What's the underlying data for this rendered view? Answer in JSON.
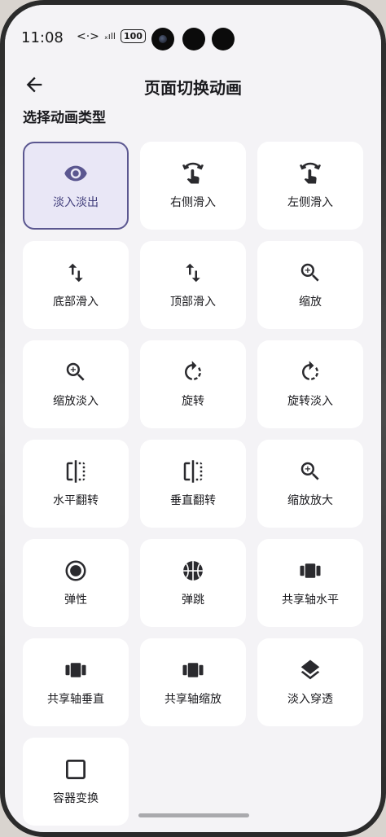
{
  "status_bar": {
    "time": "11:08",
    "network": "<·>",
    "signal": "ₓıll",
    "battery": "100"
  },
  "app_bar": {
    "title": "页面切换动画"
  },
  "section": {
    "label": "选择动画类型"
  },
  "colors": {
    "selected_border": "#5b5790",
    "selected_bg": "#e9e7f6",
    "card_bg": "#ffffff",
    "page_bg": "#f4f3f6"
  },
  "animations": [
    {
      "label": "淡入淡出",
      "icon": "eye-icon",
      "selected": true
    },
    {
      "label": "右侧滑入",
      "icon": "swipe-gesture-icon",
      "selected": false
    },
    {
      "label": "左侧滑入",
      "icon": "swipe-gesture-icon",
      "selected": false
    },
    {
      "label": "底部滑入",
      "icon": "swap-vertical-icon",
      "selected": false
    },
    {
      "label": "顶部滑入",
      "icon": "swap-vertical-icon",
      "selected": false
    },
    {
      "label": "缩放",
      "icon": "zoom-in-icon",
      "selected": false
    },
    {
      "label": "缩放淡入",
      "icon": "zoom-in-icon",
      "selected": false
    },
    {
      "label": "旋转",
      "icon": "rotate-icon",
      "selected": false
    },
    {
      "label": "旋转淡入",
      "icon": "rotate-icon",
      "selected": false
    },
    {
      "label": "水平翻转",
      "icon": "flip-icon",
      "selected": false
    },
    {
      "label": "垂直翻转",
      "icon": "flip-icon",
      "selected": false
    },
    {
      "label": "缩放放大",
      "icon": "zoom-in-icon",
      "selected": false
    },
    {
      "label": "弹性",
      "icon": "radio-target-icon",
      "selected": false
    },
    {
      "label": "弹跳",
      "icon": "basketball-icon",
      "selected": false
    },
    {
      "label": "共享轴水平",
      "icon": "view-column-icon",
      "selected": false
    },
    {
      "label": "共享轴垂直",
      "icon": "view-column-icon",
      "selected": false
    },
    {
      "label": "共享轴缩放",
      "icon": "view-column-icon",
      "selected": false
    },
    {
      "label": "淡入穿透",
      "icon": "layers-icon",
      "selected": false
    },
    {
      "label": "容器变换",
      "icon": "square-outline-icon",
      "selected": false
    }
  ]
}
